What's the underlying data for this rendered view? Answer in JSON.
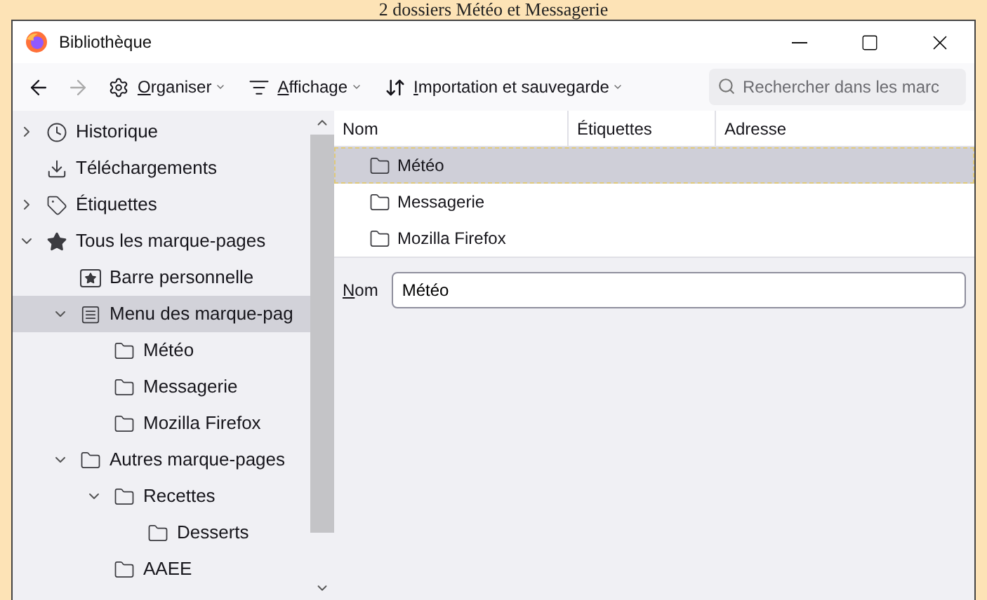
{
  "caption": "2 dossiers Météo et Messagerie",
  "window": {
    "title": "Bibliothèque"
  },
  "toolbar": {
    "back": {
      "disabled": false
    },
    "forward": {
      "disabled": true
    },
    "menus": [
      {
        "kind": "settings",
        "accesskey": "O",
        "rest": "rganiser"
      },
      {
        "kind": "view",
        "accesskey": "A",
        "rest": "ffichage"
      },
      {
        "kind": "sort",
        "accesskey": "I",
        "rest": "mportation et sauvegarde"
      }
    ],
    "search": {
      "placeholder": "Rechercher dans les marc"
    }
  },
  "sidebar": {
    "items": [
      {
        "label": "Historique",
        "kind": "history",
        "expanded": false,
        "selected": false
      },
      {
        "label": "Téléchargements",
        "kind": "downloads",
        "selected": false
      },
      {
        "label": "Étiquettes",
        "kind": "tags",
        "expanded": false,
        "selected": false
      },
      {
        "label": "Tous les marque-pages",
        "kind": "bookmarks",
        "expanded": true,
        "selected": false,
        "children": [
          {
            "label": "Barre personnelle",
            "kind": "toolbar",
            "selected": false
          },
          {
            "label": "Menu des marque-pag",
            "kind": "menu",
            "expanded": true,
            "selected": true,
            "children": [
              {
                "label": "Météo",
                "kind": "folder",
                "selected": false
              },
              {
                "label": "Messagerie",
                "kind": "folder",
                "selected": false
              },
              {
                "label": "Mozilla Firefox",
                "kind": "folder",
                "selected": false
              }
            ]
          },
          {
            "label": "Autres marque-pages",
            "kind": "folder",
            "expanded": true,
            "selected": false,
            "children": [
              {
                "label": "Recettes",
                "kind": "folder",
                "expanded": true,
                "selected": false,
                "children": [
                  {
                    "label": "Desserts",
                    "kind": "folder",
                    "selected": false
                  }
                ]
              },
              {
                "label": "AAEE",
                "kind": "folder",
                "selected": false
              }
            ]
          }
        ]
      }
    ]
  },
  "table": {
    "columns": [
      "Nom",
      "Étiquettes",
      "Adresse"
    ],
    "rows": [
      {
        "name": "Météo",
        "selected": true
      },
      {
        "name": "Messagerie",
        "selected": false
      },
      {
        "name": "Mozilla Firefox",
        "selected": false
      }
    ]
  },
  "details": {
    "label": {
      "accesskey": "N",
      "rest": "om"
    },
    "value": "Météo"
  }
}
